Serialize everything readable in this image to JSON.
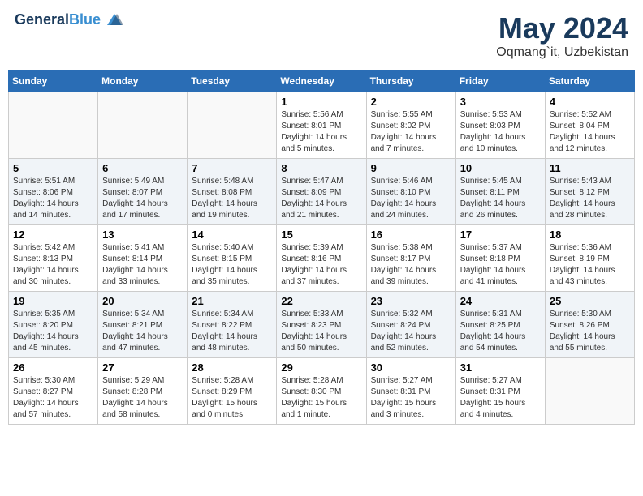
{
  "header": {
    "logo_line1": "General",
    "logo_line2": "Blue",
    "main_title": "May 2024",
    "subtitle": "Oqmang`it, Uzbekistan"
  },
  "days_of_week": [
    "Sunday",
    "Monday",
    "Tuesday",
    "Wednesday",
    "Thursday",
    "Friday",
    "Saturday"
  ],
  "weeks": [
    [
      {
        "day": "",
        "info": ""
      },
      {
        "day": "",
        "info": ""
      },
      {
        "day": "",
        "info": ""
      },
      {
        "day": "1",
        "info": "Sunrise: 5:56 AM\nSunset: 8:01 PM\nDaylight: 14 hours\nand 5 minutes."
      },
      {
        "day": "2",
        "info": "Sunrise: 5:55 AM\nSunset: 8:02 PM\nDaylight: 14 hours\nand 7 minutes."
      },
      {
        "day": "3",
        "info": "Sunrise: 5:53 AM\nSunset: 8:03 PM\nDaylight: 14 hours\nand 10 minutes."
      },
      {
        "day": "4",
        "info": "Sunrise: 5:52 AM\nSunset: 8:04 PM\nDaylight: 14 hours\nand 12 minutes."
      }
    ],
    [
      {
        "day": "5",
        "info": "Sunrise: 5:51 AM\nSunset: 8:06 PM\nDaylight: 14 hours\nand 14 minutes."
      },
      {
        "day": "6",
        "info": "Sunrise: 5:49 AM\nSunset: 8:07 PM\nDaylight: 14 hours\nand 17 minutes."
      },
      {
        "day": "7",
        "info": "Sunrise: 5:48 AM\nSunset: 8:08 PM\nDaylight: 14 hours\nand 19 minutes."
      },
      {
        "day": "8",
        "info": "Sunrise: 5:47 AM\nSunset: 8:09 PM\nDaylight: 14 hours\nand 21 minutes."
      },
      {
        "day": "9",
        "info": "Sunrise: 5:46 AM\nSunset: 8:10 PM\nDaylight: 14 hours\nand 24 minutes."
      },
      {
        "day": "10",
        "info": "Sunrise: 5:45 AM\nSunset: 8:11 PM\nDaylight: 14 hours\nand 26 minutes."
      },
      {
        "day": "11",
        "info": "Sunrise: 5:43 AM\nSunset: 8:12 PM\nDaylight: 14 hours\nand 28 minutes."
      }
    ],
    [
      {
        "day": "12",
        "info": "Sunrise: 5:42 AM\nSunset: 8:13 PM\nDaylight: 14 hours\nand 30 minutes."
      },
      {
        "day": "13",
        "info": "Sunrise: 5:41 AM\nSunset: 8:14 PM\nDaylight: 14 hours\nand 33 minutes."
      },
      {
        "day": "14",
        "info": "Sunrise: 5:40 AM\nSunset: 8:15 PM\nDaylight: 14 hours\nand 35 minutes."
      },
      {
        "day": "15",
        "info": "Sunrise: 5:39 AM\nSunset: 8:16 PM\nDaylight: 14 hours\nand 37 minutes."
      },
      {
        "day": "16",
        "info": "Sunrise: 5:38 AM\nSunset: 8:17 PM\nDaylight: 14 hours\nand 39 minutes."
      },
      {
        "day": "17",
        "info": "Sunrise: 5:37 AM\nSunset: 8:18 PM\nDaylight: 14 hours\nand 41 minutes."
      },
      {
        "day": "18",
        "info": "Sunrise: 5:36 AM\nSunset: 8:19 PM\nDaylight: 14 hours\nand 43 minutes."
      }
    ],
    [
      {
        "day": "19",
        "info": "Sunrise: 5:35 AM\nSunset: 8:20 PM\nDaylight: 14 hours\nand 45 minutes."
      },
      {
        "day": "20",
        "info": "Sunrise: 5:34 AM\nSunset: 8:21 PM\nDaylight: 14 hours\nand 47 minutes."
      },
      {
        "day": "21",
        "info": "Sunrise: 5:34 AM\nSunset: 8:22 PM\nDaylight: 14 hours\nand 48 minutes."
      },
      {
        "day": "22",
        "info": "Sunrise: 5:33 AM\nSunset: 8:23 PM\nDaylight: 14 hours\nand 50 minutes."
      },
      {
        "day": "23",
        "info": "Sunrise: 5:32 AM\nSunset: 8:24 PM\nDaylight: 14 hours\nand 52 minutes."
      },
      {
        "day": "24",
        "info": "Sunrise: 5:31 AM\nSunset: 8:25 PM\nDaylight: 14 hours\nand 54 minutes."
      },
      {
        "day": "25",
        "info": "Sunrise: 5:30 AM\nSunset: 8:26 PM\nDaylight: 14 hours\nand 55 minutes."
      }
    ],
    [
      {
        "day": "26",
        "info": "Sunrise: 5:30 AM\nSunset: 8:27 PM\nDaylight: 14 hours\nand 57 minutes."
      },
      {
        "day": "27",
        "info": "Sunrise: 5:29 AM\nSunset: 8:28 PM\nDaylight: 14 hours\nand 58 minutes."
      },
      {
        "day": "28",
        "info": "Sunrise: 5:28 AM\nSunset: 8:29 PM\nDaylight: 15 hours\nand 0 minutes."
      },
      {
        "day": "29",
        "info": "Sunrise: 5:28 AM\nSunset: 8:30 PM\nDaylight: 15 hours\nand 1 minute."
      },
      {
        "day": "30",
        "info": "Sunrise: 5:27 AM\nSunset: 8:31 PM\nDaylight: 15 hours\nand 3 minutes."
      },
      {
        "day": "31",
        "info": "Sunrise: 5:27 AM\nSunset: 8:31 PM\nDaylight: 15 hours\nand 4 minutes."
      },
      {
        "day": "",
        "info": ""
      }
    ]
  ]
}
